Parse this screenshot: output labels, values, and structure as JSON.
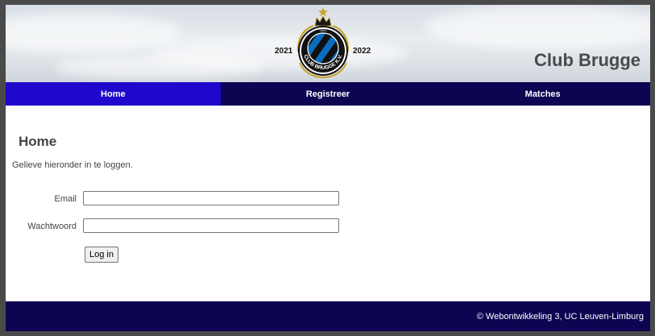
{
  "header": {
    "site_title": "Club Brugge",
    "season_start": "2021",
    "season_end": "2022",
    "logo_text": "CLUB BRUGGE K.V.",
    "logo_year": "1891",
    "colors": {
      "blue": "#0a5ea8",
      "black": "#000000",
      "gold": "#c9a227"
    }
  },
  "nav": {
    "items": [
      {
        "label": "Home",
        "active": true
      },
      {
        "label": "Registreer",
        "active": false
      },
      {
        "label": "Matches",
        "active": false
      }
    ],
    "colors": {
      "background": "#0d0452",
      "active": "#1d08cc"
    }
  },
  "main": {
    "heading": "Home",
    "intro": "Gelieve hieronder in te loggen.",
    "form": {
      "email_label": "Email",
      "email_value": "",
      "password_label": "Wachtwoord",
      "password_value": "",
      "submit_label": "Log in"
    }
  },
  "footer": {
    "text": "© Webontwikkeling 3, UC Leuven-Limburg"
  }
}
